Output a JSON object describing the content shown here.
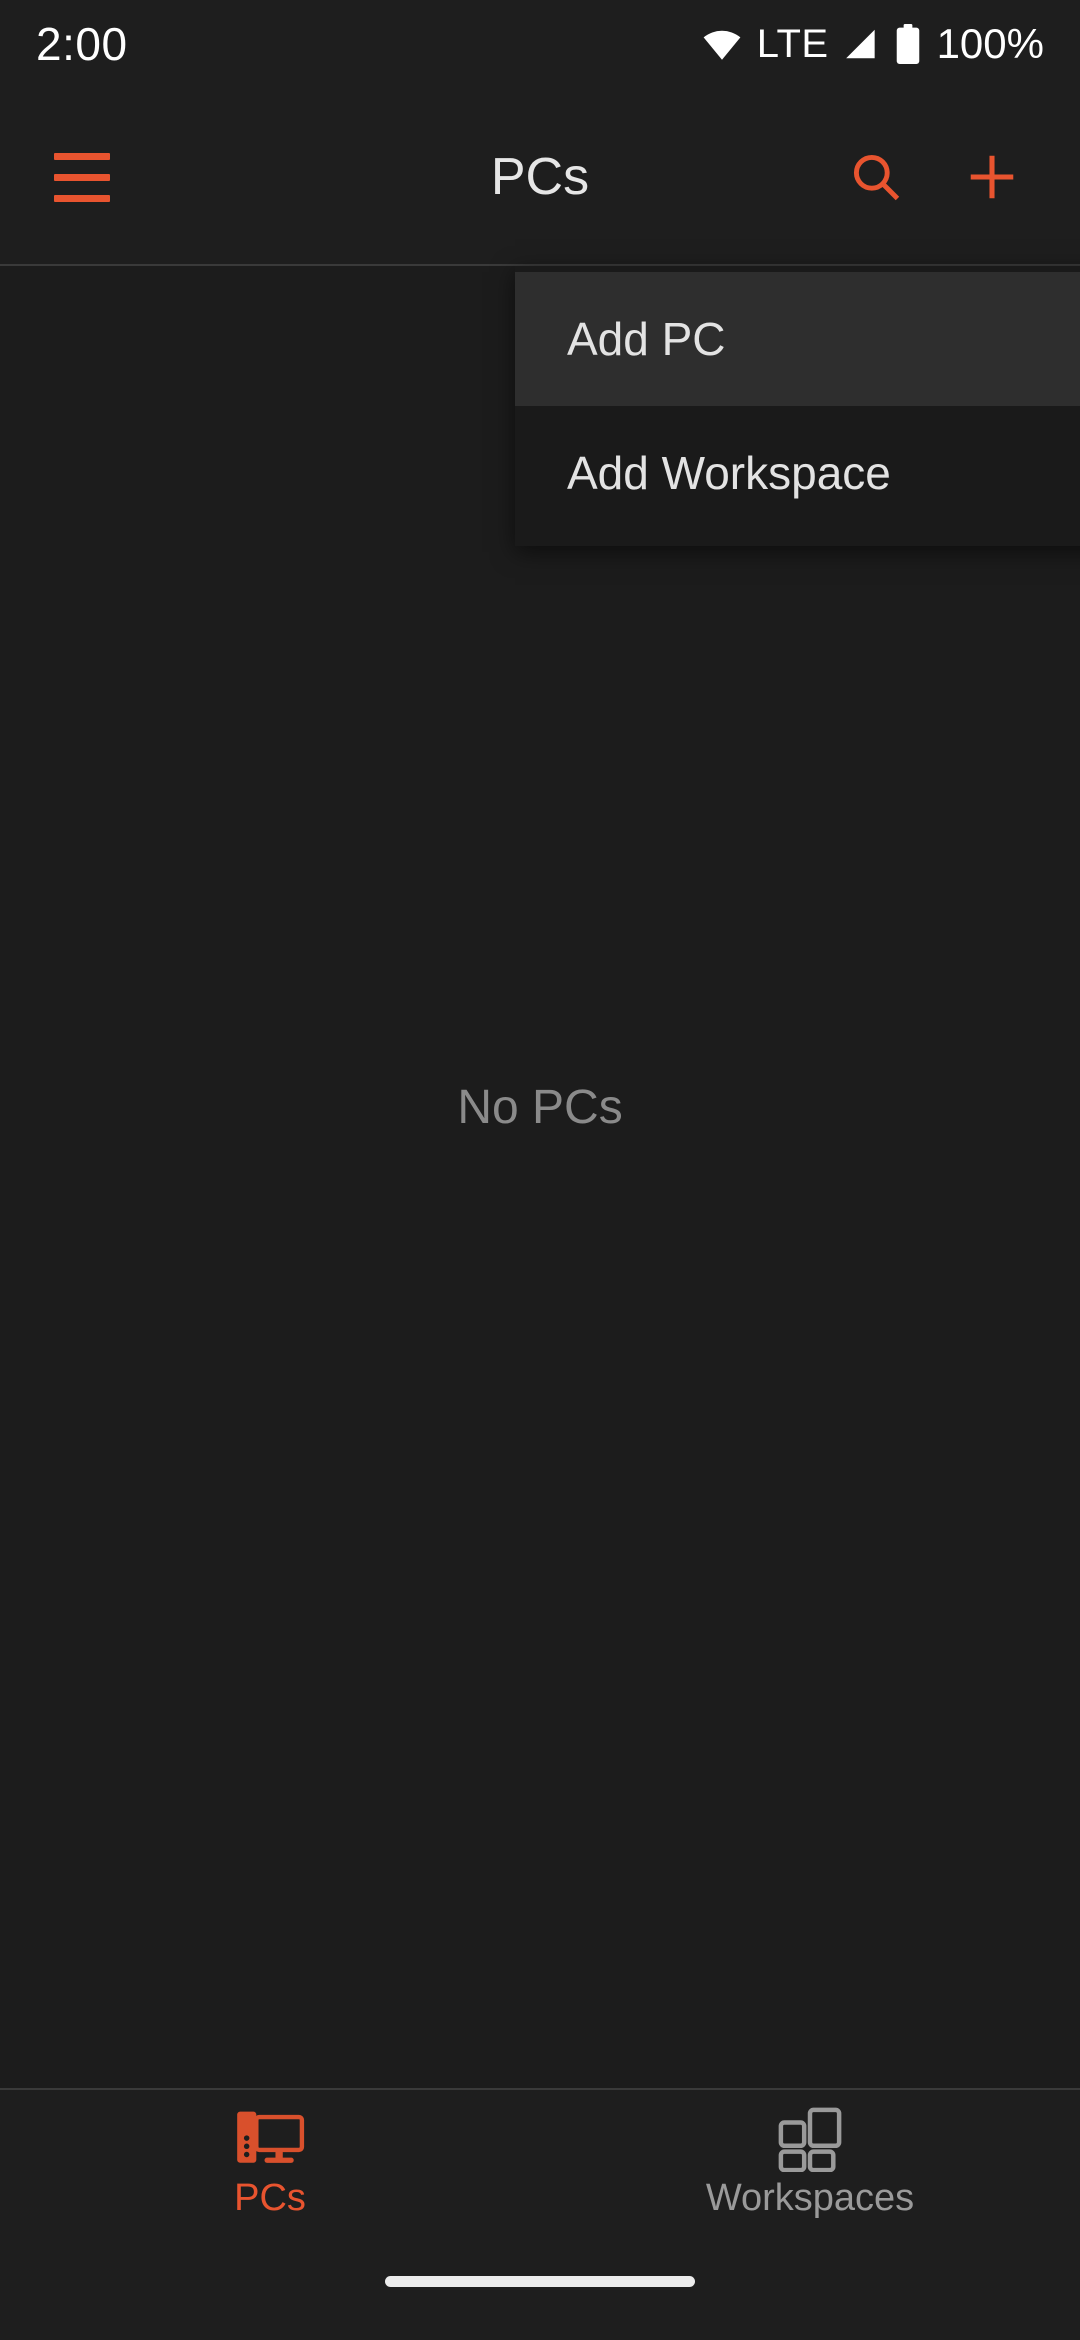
{
  "status_bar": {
    "clock": "2:00",
    "network_label": "LTE",
    "battery_percent": "100%",
    "icons": {
      "wifi": "wifi-icon",
      "signal": "signal-bars-icon",
      "battery": "battery-full-icon"
    }
  },
  "app_bar": {
    "title": "PCs",
    "menu_icon": "hamburger-menu-icon",
    "search_icon": "search-icon",
    "add_icon": "plus-icon",
    "accent_color": "#e8542f"
  },
  "popup_menu": {
    "items": [
      {
        "label": "Add PC",
        "highlighted": true
      },
      {
        "label": "Add Workspace",
        "highlighted": false
      }
    ]
  },
  "content": {
    "empty_state_label": "No PCs"
  },
  "bottom_nav": {
    "items": [
      {
        "label": "PCs",
        "icon": "desktop-pc-icon",
        "active": true
      },
      {
        "label": "Workspaces",
        "icon": "workspaces-grid-icon",
        "active": false
      }
    ],
    "active_color": "#e8542f",
    "inactive_color": "#9a9a9a"
  }
}
